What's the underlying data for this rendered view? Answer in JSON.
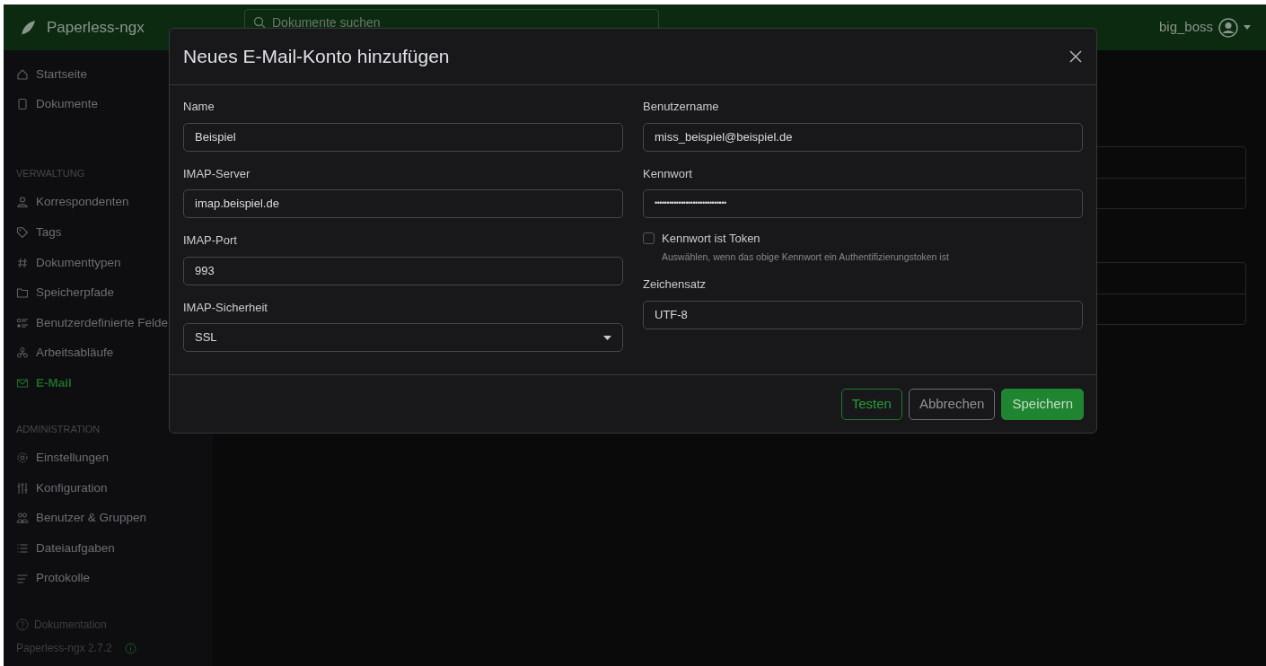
{
  "navbar": {
    "brand": "Paperless-ngx",
    "search": {
      "placeholder": "Dokumente suchen"
    },
    "user": "big_boss"
  },
  "sidebar": {
    "sections": [
      {
        "items": [
          {
            "label": "Startseite",
            "selected": false
          },
          {
            "label": "Dokumente",
            "selected": false
          }
        ]
      },
      {
        "heading": "VERWALTUNG",
        "items": [
          {
            "label": "Korrespondenten",
            "selected": false
          },
          {
            "label": "Tags",
            "selected": false
          },
          {
            "label": "Dokumenttypen",
            "selected": false
          },
          {
            "label": "Speicherpfade",
            "selected": false
          },
          {
            "label": "Benutzerdefinierte Felde",
            "selected": false
          },
          {
            "label": "Arbeitsabläufe",
            "selected": false
          },
          {
            "label": "E-Mail",
            "selected": true
          }
        ]
      },
      {
        "heading": "ADMINISTRATION",
        "items": [
          {
            "label": "Einstellungen",
            "selected": false
          },
          {
            "label": "Konfiguration",
            "selected": false
          },
          {
            "label": "Benutzer & Gruppen",
            "selected": false
          },
          {
            "label": "Dateiaufgaben",
            "selected": false
          },
          {
            "label": "Protokolle",
            "selected": false
          }
        ]
      }
    ],
    "docs_link": "Dokumentation",
    "version": "Paperless-ngx 2.7.2"
  },
  "dialog": {
    "title": "Neues E-Mail-Konto hinzufügen",
    "left": [
      {
        "kind": "text",
        "label": "Name",
        "value": "Beispiel"
      },
      {
        "kind": "text",
        "label": "IMAP-Server",
        "value": "imap.beispiel.de"
      },
      {
        "kind": "text",
        "label": "IMAP-Port",
        "value": "993"
      },
      {
        "kind": "select",
        "label": "IMAP-Sicherheit",
        "value": "SSL"
      }
    ],
    "right": [
      {
        "kind": "text",
        "label": "Benutzername",
        "value": "miss_beispiel@beispiel.de"
      },
      {
        "kind": "password",
        "label": "Kennwort",
        "value": "••••••••••••••••••••••••••••••"
      },
      {
        "kind": "checkbox",
        "label": "Kennwort ist Token",
        "checked": false,
        "hint": "Auswählen, wenn das obige Kennwort ein Authentifizierungstoken ist"
      },
      {
        "kind": "text",
        "label": "Zeichensatz",
        "value": "UTF-8"
      }
    ],
    "buttons": [
      {
        "label": "Testen",
        "kind": "outline-success"
      },
      {
        "label": "Abbrechen",
        "kind": "outline-secondary"
      },
      {
        "label": "Speichern",
        "kind": "primary"
      }
    ]
  }
}
